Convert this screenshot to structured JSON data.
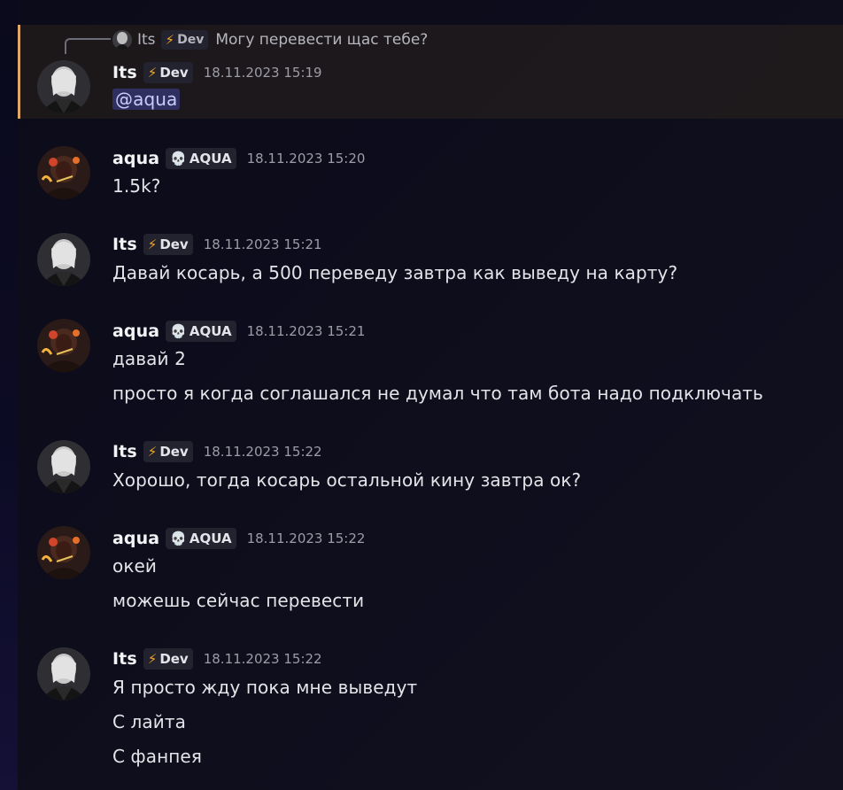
{
  "reply": {
    "author": "Its",
    "tag": "Dev",
    "text": "Могу перевести щас тебе?"
  },
  "messages": [
    {
      "author": "Its",
      "tag": "Dev",
      "tag_icon": "lightning-icon",
      "timestamp": "18.11.2023 15:19",
      "mention": "@aqua"
    },
    {
      "author": "aqua",
      "tag": "AQUA",
      "tag_icon": "skull-icon",
      "timestamp": "18.11.2023 15:20",
      "lines": [
        "1.5k?"
      ]
    },
    {
      "author": "Its",
      "tag": "Dev",
      "tag_icon": "lightning-icon",
      "timestamp": "18.11.2023 15:21",
      "lines": [
        "Давай косарь, а 500 переведу завтра как выведу на карту?"
      ]
    },
    {
      "author": "aqua",
      "tag": "AQUA",
      "tag_icon": "skull-icon",
      "timestamp": "18.11.2023 15:21",
      "lines": [
        "давай 2",
        "просто я когда соглашался не думал что там бота надо подключать"
      ]
    },
    {
      "author": "Its",
      "tag": "Dev",
      "tag_icon": "lightning-icon",
      "timestamp": "18.11.2023 15:22",
      "lines": [
        "Хорошо, тогда косарь остальной кину завтра ок?"
      ]
    },
    {
      "author": "aqua",
      "tag": "AQUA",
      "tag_icon": "skull-icon",
      "timestamp": "18.11.2023 15:22",
      "lines": [
        "окей",
        "можешь сейчас перевести"
      ]
    },
    {
      "author": "Its",
      "tag": "Dev",
      "tag_icon": "lightning-icon",
      "timestamp": "18.11.2023 15:22",
      "lines": [
        "Я просто жду пока мне выведут",
        "С лайта",
        "С фанпея"
      ]
    }
  ],
  "colors": {
    "highlight_border": "#e0a866",
    "mention_bg": "#5865f2",
    "dev_icon": "#f5a623",
    "aqua_icon": "#a78bfa"
  }
}
